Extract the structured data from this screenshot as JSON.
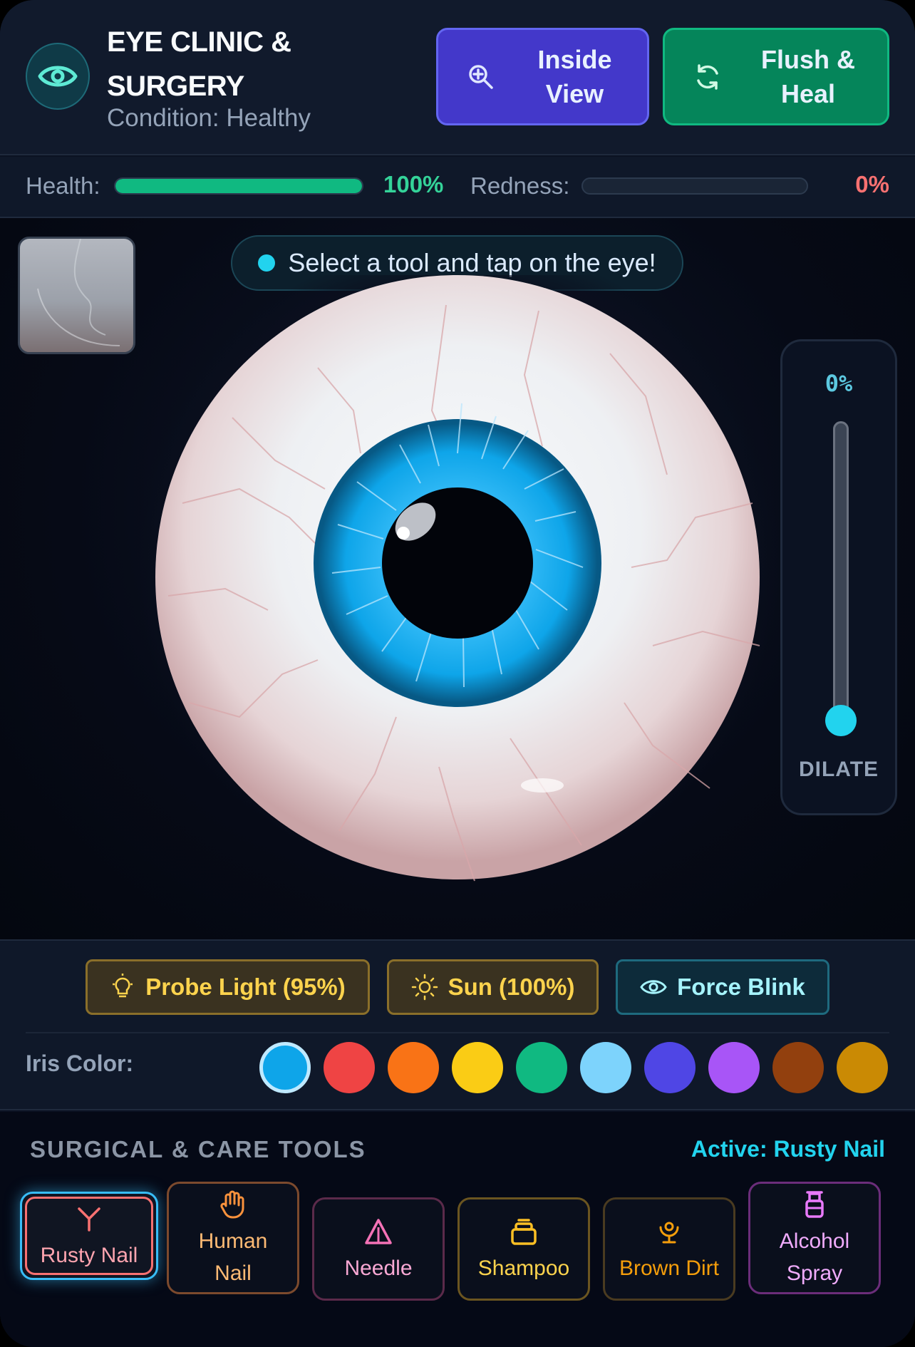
{
  "header": {
    "title": "EYE CLINIC & SURGERY",
    "condition": "Condition: Healthy",
    "logo_icon": "eye-icon",
    "inside_view_label": "Inside View",
    "flush_heal_label": "Flush & Heal"
  },
  "stats": {
    "health_label": "Health:",
    "health_value": "100%",
    "health_level": 1.0,
    "redness_label": "Redness:",
    "redness_value": "0%",
    "redness_level": 0.0
  },
  "stage": {
    "hint": "Select a tool and tap on the eye!",
    "dilate_value": "0%",
    "dilate_level": 0.0,
    "dilate_label": "DILATE"
  },
  "controls": {
    "probe_light": "Probe Light (95%)",
    "sun": "Sun (100%)",
    "force_blink": "Force Blink",
    "iris_label": "Iris Color:",
    "iris_colors": [
      "#0ea5e9",
      "#ef4444",
      "#f97316",
      "#facc15",
      "#10b981",
      "#7dd3fc",
      "#4f46e5",
      "#a855f7",
      "#92400e",
      "#ca8a04"
    ],
    "selected_iris": "#0ea5e9"
  },
  "tools": {
    "title": "SURGICAL & CARE TOOLS",
    "active": "Active: Rusty Nail",
    "items": [
      {
        "label": "Rusty Nail",
        "icon": "utensils-icon",
        "color": "#fda4af"
      },
      {
        "label": "Human Nail",
        "icon": "hand-icon",
        "color": "#fdba74"
      },
      {
        "label": "Needle",
        "icon": "triangle-icon",
        "color": "#f9a8d4"
      },
      {
        "label": "Shampoo",
        "icon": "bottle-icon",
        "color": "#fcd34d"
      },
      {
        "label": "Brown Dirt",
        "icon": "shovel-icon",
        "color": "#f59e0b"
      },
      {
        "label": "Alcohol Spray",
        "icon": "spray-bottle-icon",
        "color": "#f0abfc"
      }
    ]
  },
  "colors": {
    "accent": "#22d3ee",
    "health_green": "#10b981",
    "redness_red": "#f87171"
  }
}
